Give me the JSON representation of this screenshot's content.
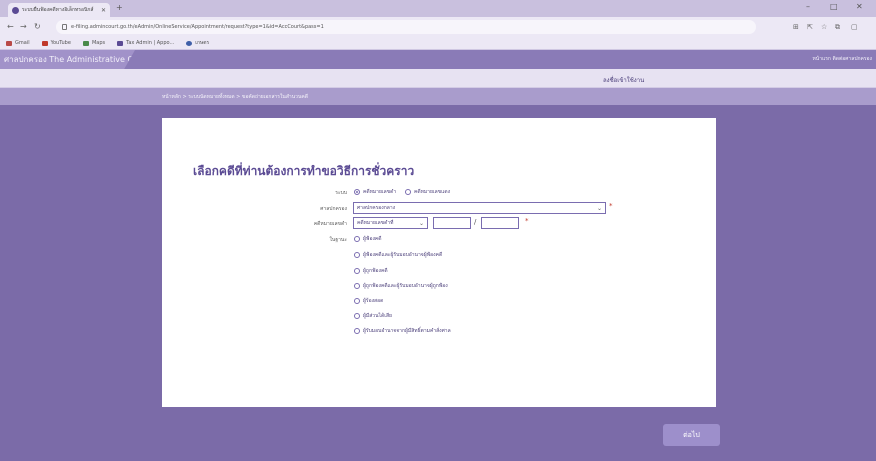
{
  "browser": {
    "tab_title": "ระบบยื่นฟ้องคดีทางอิเล็กทรอนิกส์",
    "url": "e-filing.admincourt.go.th/eAdmin/OnlineService/Appointment/request?type=1&id=AccCourt&pass=1",
    "bookmarks": [
      "Gmail",
      "YouTube",
      "Maps",
      "Tax Admin | Appo...",
      "เกษตร"
    ]
  },
  "site": {
    "brand": "ศาลปกครอง The Administrative Court",
    "header_links": "หน้าแรก  ติดต่อศาลปกครอง",
    "login": "ลงชื่อเข้าใช้งาน",
    "breadcrumb": "หน้าหลัก  >  ระบบนัดหมายทั้งหมด  >  ขอคัดถ่ายเอกสารในสำนวนคดี"
  },
  "form": {
    "title": "เลือกคดีที่ท่านต้องการทำขอวิธีการชั่วคราว",
    "row1_label": "ระบบ",
    "row1_opt1": "คดีหมายเลขดำ",
    "row1_opt2": "คดีหมายเลขแดง",
    "court_label": "ศาลปกครอง",
    "court_value": "ศาลปกครองกลาง",
    "case_label": "คดีหมายเลขดำ",
    "case_prefix": "คดีหมายเลขดำที่",
    "role_label": "ในฐานะ",
    "roles": [
      "ผู้ฟ้องคดี",
      "ผู้ฟ้องคดีและผู้รับมอบอำนาจผู้ฟ้องคดี",
      "ผู้ถูกฟ้องคดี",
      "ผู้ถูกฟ้องคดีและผู้รับมอบอำนาจผู้ถูกฟ้อง",
      "ผู้ร้องสอด",
      "ผู้มีส่วนได้เสีย",
      "ผู้รับมอบอำนาจจากผู้มีสิทธิ์ตามคำสั่งศาล"
    ],
    "required_mark": "*",
    "slash": "/"
  },
  "next_label": "ต่อไป"
}
